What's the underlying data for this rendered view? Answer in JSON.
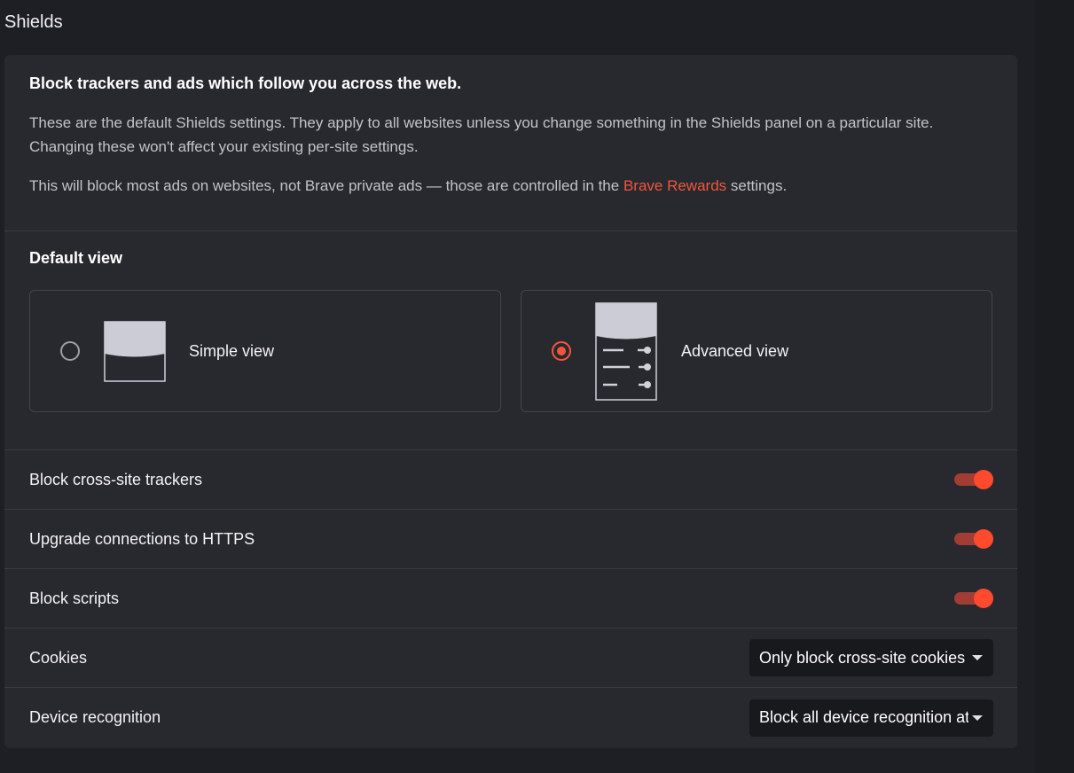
{
  "page": {
    "title": "Shields"
  },
  "intro": {
    "title": "Block trackers and ads which follow you across the web.",
    "description": "These are the default Shields settings. They apply to all websites unless you change something in the Shields panel on a particular site. Changing these won't affect your existing per-site settings.",
    "ads_note_prefix": "This will block most ads on websites, not Brave private ads — those are controlled in the ",
    "ads_note_link": "Brave Rewards",
    "ads_note_suffix": " settings."
  },
  "default_view": {
    "title": "Default view",
    "options": [
      {
        "label": "Simple view",
        "icon": "simple-view-icon",
        "selected": false
      },
      {
        "label": "Advanced view",
        "icon": "advanced-view-icon",
        "selected": true
      }
    ]
  },
  "settings": {
    "cross_site_trackers": {
      "label": "Block cross-site trackers",
      "enabled": true
    },
    "https_upgrade": {
      "label": "Upgrade connections to HTTPS",
      "enabled": true
    },
    "block_scripts": {
      "label": "Block scripts",
      "enabled": true
    },
    "cookies": {
      "label": "Cookies",
      "selected": "Only block cross-site cookies"
    },
    "device_recognition": {
      "label": "Device recognition",
      "selected": "Block all device recognition attempts"
    }
  },
  "colors": {
    "accent": "#f1563c",
    "toggle_knob": "#ff4a2e",
    "toggle_track": "#a13d33",
    "card_bg": "#28292e",
    "page_bg": "#1e1f24"
  }
}
